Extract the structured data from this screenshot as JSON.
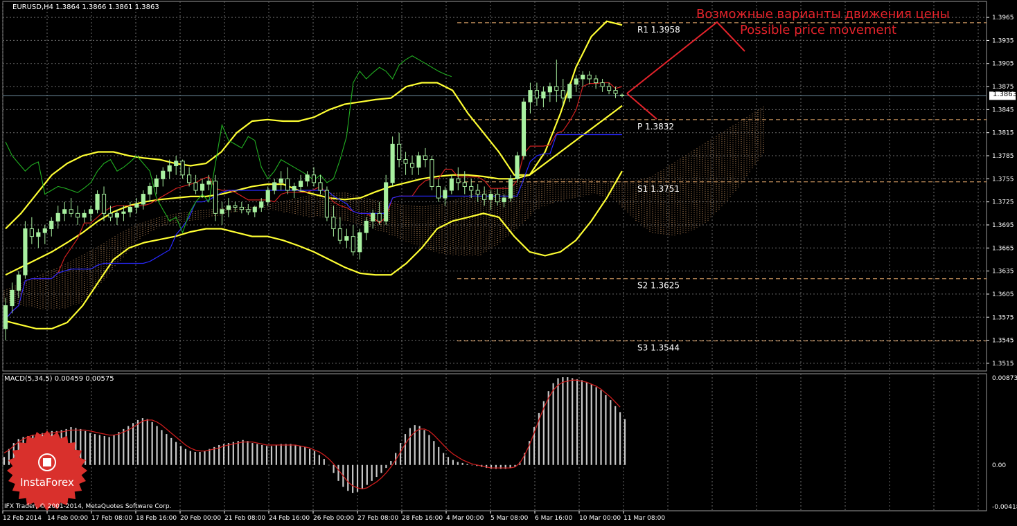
{
  "header": {
    "symbol_label": "EURUSD,H4  1.3864 1.3866 1.3861 1.3863",
    "dropdown_icon": "triangle-down-icon"
  },
  "annotation": {
    "line1": "Возможные варианты движения цены",
    "line2": "Possible price movement",
    "color": "#e5232b"
  },
  "footer": {
    "copyright": "IFX Trader, © 2001-2014, MetaQuotes Software Corp."
  },
  "logo": {
    "text": "InstaForex",
    "color": "#d9302c"
  },
  "colors": {
    "background": "#000000",
    "grid": "#6b6b6b",
    "axis_text": "#ffffff",
    "candle": "#a8f0a0",
    "bollinger": "#ffff33",
    "tenkan": "#d02020",
    "kijun": "#2828ff",
    "chikou": "#22b022",
    "cloud": "#f0b070",
    "pivot": "#f0b070",
    "current_price_line": "#6e8ea0",
    "macd_hist": "#c8c8c8",
    "macd_signal": "#cc1c1c"
  },
  "chart_data": [
    {
      "type": "candlestick",
      "title": "EURUSD,H4",
      "ylim": [
        1.3505,
        1.3975
      ],
      "y_ticks": [
        "1.3965",
        "1.3935",
        "1.3905",
        "1.3875",
        "1.3845",
        "1.3815",
        "1.3785",
        "1.3755",
        "1.3725",
        "1.3695",
        "1.3665",
        "1.3635",
        "1.3605",
        "1.3575",
        "1.3545",
        "1.3515"
      ],
      "current_price": "1.3863",
      "x_ticks": [
        "12 Feb 2014",
        "14 Feb 00:00",
        "17 Feb 08:00",
        "18 Feb 16:00",
        "20 Feb 00:00",
        "21 Feb 08:00",
        "24 Feb 16:00",
        "26 Feb 00:00",
        "27 Feb 08:00",
        "28 Feb 16:00",
        "4 Mar 00:00",
        "5 Mar 08:00",
        "6 Mar 16:00",
        "10 Mar 00:00",
        "11 Mar 08:00"
      ],
      "levels": [
        {
          "name": "R1",
          "label": "R1  1.3958",
          "value": 1.3958
        },
        {
          "name": "P",
          "label": "P  1.3832",
          "value": 1.3832
        },
        {
          "name": "S1",
          "label": "S1  1.3751",
          "value": 1.3751
        },
        {
          "name": "S2",
          "label": "S2  1.3625",
          "value": 1.3625
        },
        {
          "name": "S3",
          "label": "S3  1.3544",
          "value": 1.3544
        }
      ],
      "candles_ohlc": [
        [
          1.356,
          1.36,
          1.3545,
          1.359
        ],
        [
          1.359,
          1.362,
          1.358,
          1.361
        ],
        [
          1.361,
          1.3635,
          1.36,
          1.363
        ],
        [
          1.363,
          1.37,
          1.3625,
          1.369
        ],
        [
          1.369,
          1.3705,
          1.367,
          1.368
        ],
        [
          1.368,
          1.369,
          1.3665,
          1.3685
        ],
        [
          1.3685,
          1.3695,
          1.367,
          1.369
        ],
        [
          1.369,
          1.3705,
          1.368,
          1.37
        ],
        [
          1.37,
          1.372,
          1.369,
          1.371
        ],
        [
          1.371,
          1.3725,
          1.37,
          1.3715
        ],
        [
          1.3715,
          1.373,
          1.3705,
          1.371
        ],
        [
          1.371,
          1.372,
          1.3695,
          1.3705
        ],
        [
          1.3705,
          1.3715,
          1.3698,
          1.371
        ],
        [
          1.371,
          1.372,
          1.37,
          1.3715
        ],
        [
          1.3715,
          1.374,
          1.371,
          1.3735
        ],
        [
          1.3735,
          1.3745,
          1.37,
          1.371
        ],
        [
          1.371,
          1.372,
          1.37,
          1.3705
        ],
        [
          1.3705,
          1.3715,
          1.3695,
          1.371
        ],
        [
          1.371,
          1.372,
          1.37,
          1.3712
        ],
        [
          1.3712,
          1.3725,
          1.3705,
          1.3718
        ],
        [
          1.3718,
          1.373,
          1.371,
          1.3722
        ],
        [
          1.3722,
          1.374,
          1.3715,
          1.3735
        ],
        [
          1.3735,
          1.375,
          1.3725,
          1.3745
        ],
        [
          1.3745,
          1.376,
          1.3735,
          1.3755
        ],
        [
          1.3755,
          1.377,
          1.3745,
          1.3765
        ],
        [
          1.3765,
          1.378,
          1.3755,
          1.3772
        ],
        [
          1.3772,
          1.3785,
          1.376,
          1.3778
        ],
        [
          1.3778,
          1.378,
          1.3755,
          1.376
        ],
        [
          1.376,
          1.377,
          1.3745,
          1.375
        ],
        [
          1.375,
          1.376,
          1.3735,
          1.374
        ],
        [
          1.374,
          1.3755,
          1.373,
          1.3748
        ],
        [
          1.3748,
          1.376,
          1.374,
          1.3752
        ],
        [
          1.3752,
          1.376,
          1.37,
          1.371
        ],
        [
          1.371,
          1.3725,
          1.3695,
          1.3715
        ],
        [
          1.3715,
          1.373,
          1.3705,
          1.372
        ],
        [
          1.372,
          1.3725,
          1.3712,
          1.3718
        ],
        [
          1.3718,
          1.3725,
          1.371,
          1.3715
        ],
        [
          1.3715,
          1.3722,
          1.3708,
          1.3712
        ],
        [
          1.3712,
          1.372,
          1.3705,
          1.3718
        ],
        [
          1.3718,
          1.373,
          1.3712,
          1.3725
        ],
        [
          1.3725,
          1.3745,
          1.372,
          1.374
        ],
        [
          1.374,
          1.3755,
          1.3735,
          1.375
        ],
        [
          1.375,
          1.3765,
          1.374,
          1.3755
        ],
        [
          1.3755,
          1.377,
          1.3735,
          1.374
        ],
        [
          1.374,
          1.375,
          1.373,
          1.3745
        ],
        [
          1.3745,
          1.376,
          1.3738,
          1.3752
        ],
        [
          1.3752,
          1.3765,
          1.3745,
          1.376
        ],
        [
          1.376,
          1.377,
          1.3745,
          1.375
        ],
        [
          1.375,
          1.376,
          1.3735,
          1.374
        ],
        [
          1.374,
          1.3745,
          1.37,
          1.3705
        ],
        [
          1.3705,
          1.372,
          1.368,
          1.369
        ],
        [
          1.369,
          1.3705,
          1.367,
          1.3675
        ],
        [
          1.3675,
          1.369,
          1.3665,
          1.368
        ],
        [
          1.368,
          1.3695,
          1.3655,
          1.366
        ],
        [
          1.366,
          1.369,
          1.365,
          1.3685
        ],
        [
          1.3685,
          1.3705,
          1.3675,
          1.37
        ],
        [
          1.37,
          1.3715,
          1.369,
          1.371
        ],
        [
          1.371,
          1.3725,
          1.3695,
          1.37
        ],
        [
          1.37,
          1.376,
          1.3695,
          1.375
        ],
        [
          1.375,
          1.381,
          1.3745,
          1.38
        ],
        [
          1.38,
          1.3815,
          1.377,
          1.378
        ],
        [
          1.378,
          1.379,
          1.376,
          1.3775
        ],
        [
          1.3775,
          1.3785,
          1.376,
          1.377
        ],
        [
          1.377,
          1.379,
          1.376,
          1.3785
        ],
        [
          1.3785,
          1.3795,
          1.377,
          1.378
        ],
        [
          1.378,
          1.3785,
          1.374,
          1.3745
        ],
        [
          1.3745,
          1.3755,
          1.3725,
          1.373
        ],
        [
          1.373,
          1.3745,
          1.372,
          1.374
        ],
        [
          1.374,
          1.376,
          1.3735,
          1.3755
        ],
        [
          1.3755,
          1.377,
          1.374,
          1.375
        ],
        [
          1.375,
          1.3765,
          1.3735,
          1.3745
        ],
        [
          1.3745,
          1.3755,
          1.373,
          1.374
        ],
        [
          1.374,
          1.3748,
          1.3725,
          1.3735
        ],
        [
          1.3735,
          1.3745,
          1.372,
          1.3728
        ],
        [
          1.3728,
          1.374,
          1.3715,
          1.3735
        ],
        [
          1.3735,
          1.3742,
          1.372,
          1.3725
        ],
        [
          1.3725,
          1.3735,
          1.3718,
          1.373
        ],
        [
          1.373,
          1.376,
          1.3725,
          1.3755
        ],
        [
          1.3755,
          1.379,
          1.375,
          1.3785
        ],
        [
          1.3785,
          1.386,
          1.378,
          1.3855
        ],
        [
          1.3855,
          1.388,
          1.384,
          1.387
        ],
        [
          1.387,
          1.388,
          1.385,
          1.386
        ],
        [
          1.386,
          1.3875,
          1.3848,
          1.3868
        ],
        [
          1.3868,
          1.388,
          1.3855,
          1.3875
        ],
        [
          1.3875,
          1.391,
          1.3855,
          1.387
        ],
        [
          1.387,
          1.3885,
          1.385,
          1.386
        ],
        [
          1.386,
          1.388,
          1.3855,
          1.3878
        ],
        [
          1.3878,
          1.389,
          1.3868,
          1.3885
        ],
        [
          1.3885,
          1.3895,
          1.3875,
          1.389
        ],
        [
          1.389,
          1.3895,
          1.3878,
          1.3885
        ],
        [
          1.3885,
          1.389,
          1.3872,
          1.388
        ],
        [
          1.388,
          1.3885,
          1.3868,
          1.3875
        ],
        [
          1.3875,
          1.388,
          1.3865,
          1.387
        ],
        [
          1.387,
          1.3875,
          1.386,
          1.3866
        ],
        [
          1.3864,
          1.3866,
          1.3861,
          1.3863
        ]
      ],
      "bollinger_upper": [
        1.369,
        1.371,
        1.3735,
        1.376,
        1.3775,
        1.3785,
        1.379,
        1.379,
        1.3785,
        1.3782,
        1.378,
        1.3775,
        1.3772,
        1.3775,
        1.379,
        1.3815,
        1.383,
        1.3832,
        1.383,
        1.383,
        1.3835,
        1.3845,
        1.3852,
        1.3855,
        1.3858,
        1.386,
        1.3875,
        1.388,
        1.388,
        1.387,
        1.384,
        1.3815,
        1.379,
        1.376,
        1.376,
        1.379,
        1.384,
        1.39,
        1.394,
        1.396,
        1.3955
      ],
      "bollinger_middle": [
        1.363,
        1.364,
        1.365,
        1.366,
        1.3672,
        1.3685,
        1.37,
        1.3712,
        1.372,
        1.3725,
        1.3728,
        1.373,
        1.3732,
        1.3732,
        1.3735,
        1.374,
        1.3745,
        1.3748,
        1.3748,
        1.374,
        1.3735,
        1.373,
        1.3728,
        1.373,
        1.3738,
        1.3745,
        1.375,
        1.3755,
        1.3758,
        1.376,
        1.376,
        1.3758,
        1.3755,
        1.3755,
        1.376,
        1.3775,
        1.379,
        1.3805,
        1.382,
        1.3835,
        1.385
      ],
      "bollinger_lower": [
        1.357,
        1.3565,
        1.356,
        1.356,
        1.3568,
        1.359,
        1.362,
        1.365,
        1.3665,
        1.3672,
        1.3676,
        1.368,
        1.3686,
        1.369,
        1.369,
        1.3685,
        1.368,
        1.368,
        1.3675,
        1.3668,
        1.366,
        1.365,
        1.364,
        1.3632,
        1.363,
        1.363,
        1.3645,
        1.3665,
        1.369,
        1.37,
        1.3705,
        1.371,
        1.3705,
        1.368,
        1.366,
        1.3655,
        1.366,
        1.3675,
        1.37,
        1.373,
        1.3765
      ],
      "macd": {
        "label": "MACD(5,34,5) 0.00459 0.00575",
        "ylim": [
          -0.00418,
          0.00873
        ],
        "y_ticks": [
          "0.00873",
          "0.00",
          "-0.00418"
        ],
        "histogram": [
          0.0008,
          0.0016,
          0.0022,
          0.0026,
          0.0028,
          0.0029,
          0.003,
          0.0031,
          0.0032,
          0.0033,
          0.0034,
          0.0034,
          0.0035,
          0.0036,
          0.0038,
          0.0037,
          0.0036,
          0.0034,
          0.0032,
          0.0031,
          0.003,
          0.0029,
          0.0028,
          0.003,
          0.0033,
          0.0036,
          0.0039,
          0.0042,
          0.0045,
          0.0047,
          0.0046,
          0.0043,
          0.0039,
          0.0035,
          0.0031,
          0.0027,
          0.0023,
          0.0019,
          0.0016,
          0.0014,
          0.0013,
          0.0013,
          0.0014,
          0.0016,
          0.0018,
          0.002,
          0.0021,
          0.0022,
          0.0023,
          0.0024,
          0.0025,
          0.0024,
          0.0022,
          0.0021,
          0.002,
          0.0019,
          0.0019,
          0.002,
          0.0021,
          0.0021,
          0.0021,
          0.002,
          0.0019,
          0.0018,
          0.0016,
          0.0014,
          0.001,
          0.0006,
          0.0,
          -0.0008,
          -0.0016,
          -0.0022,
          -0.0026,
          -0.0028,
          -0.0027,
          -0.0024,
          -0.002,
          -0.0016,
          -0.0012,
          -0.0008,
          -0.0003,
          0.0004,
          0.0012,
          0.0022,
          0.0031,
          0.0037,
          0.004,
          0.0039,
          0.0035,
          0.003,
          0.0024,
          0.0018,
          0.0012,
          0.0008,
          0.0005,
          0.0003,
          0.0002,
          0.0001,
          0.0,
          -0.0001,
          -0.0002,
          -0.0003,
          -0.0004,
          -0.0004,
          -0.0004,
          -0.0004,
          -0.0003,
          -0.0002,
          0.0003,
          0.0012,
          0.0024,
          0.0038,
          0.0052,
          0.0064,
          0.0074,
          0.0082,
          0.0087,
          0.0088,
          0.0088,
          0.0087,
          0.0086,
          0.0085,
          0.0083,
          0.0081,
          0.0078,
          0.0075,
          0.007,
          0.0065,
          0.0059,
          0.0053,
          0.0046
        ],
        "signal": [
          0.0012,
          0.0015,
          0.0019,
          0.0023,
          0.0026,
          0.0028,
          0.003,
          0.003,
          0.0031,
          0.0032,
          0.0032,
          0.0033,
          0.0033,
          0.0034,
          0.0035,
          0.0035,
          0.0035,
          0.0035,
          0.0034,
          0.0033,
          0.0032,
          0.0031,
          0.003,
          0.003,
          0.0031,
          0.0033,
          0.0035,
          0.0038,
          0.0041,
          0.0044,
          0.0045,
          0.0045,
          0.0043,
          0.004,
          0.0036,
          0.0032,
          0.0028,
          0.0024,
          0.002,
          0.0017,
          0.0015,
          0.0014,
          0.0014,
          0.0015,
          0.0016,
          0.0017,
          0.0019,
          0.002,
          0.0021,
          0.0022,
          0.0023,
          0.0023,
          0.0023,
          0.0022,
          0.0021,
          0.002,
          0.002,
          0.002,
          0.002,
          0.002,
          0.002,
          0.002,
          0.0019,
          0.0018,
          0.0017,
          0.0015,
          0.0013,
          0.001,
          0.0006,
          0.0001,
          -0.0005,
          -0.0011,
          -0.0017,
          -0.0021,
          -0.0023,
          -0.0024,
          -0.0023,
          -0.002,
          -0.0017,
          -0.0013,
          -0.0008,
          -0.0002,
          0.0005,
          0.0013,
          0.0021,
          0.0028,
          0.0033,
          0.0036,
          0.0036,
          0.0034,
          0.003,
          0.0025,
          0.002,
          0.0015,
          0.0011,
          0.0008,
          0.0005,
          0.0003,
          0.0001,
          -0.0,
          -0.0001,
          -0.0002,
          -0.0003,
          -0.0003,
          -0.0003,
          -0.0003,
          -0.0003,
          -0.0002,
          0.0002,
          0.001,
          0.002,
          0.0032,
          0.0045,
          0.0057,
          0.0067,
          0.0075,
          0.008,
          0.0083,
          0.0084,
          0.0085,
          0.0085,
          0.0084,
          0.0083,
          0.0081,
          0.0079,
          0.0076,
          0.0072,
          0.0068,
          0.0063,
          0.0058
        ]
      }
    }
  ]
}
